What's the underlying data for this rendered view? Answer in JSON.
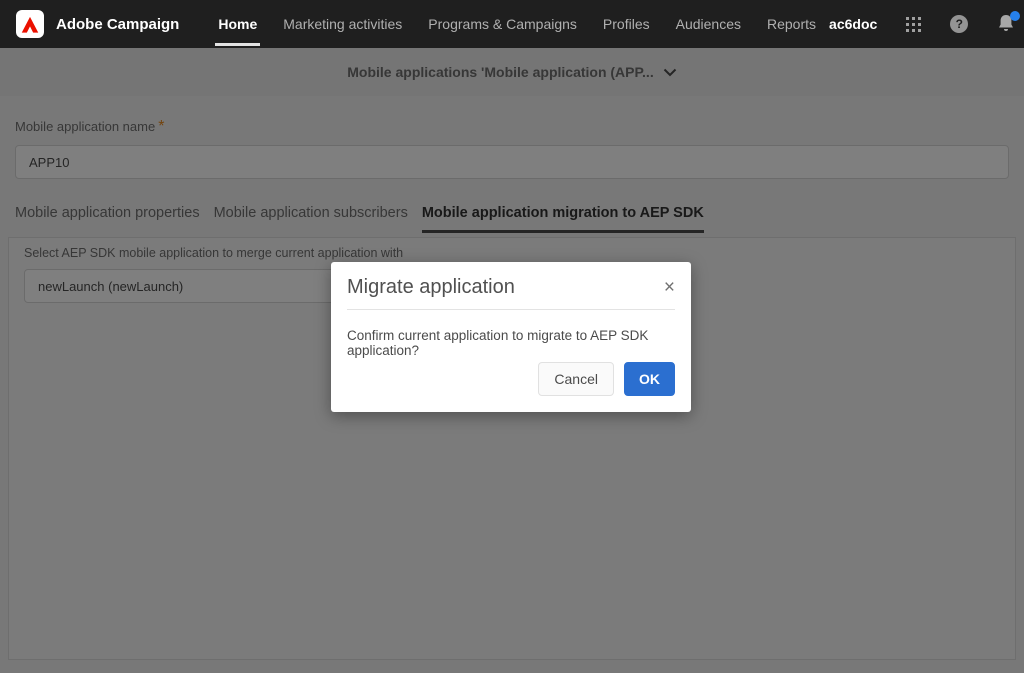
{
  "nav": {
    "brand": "Adobe Campaign",
    "items": [
      "Home",
      "Marketing activities",
      "Programs & Campaigns",
      "Profiles",
      "Audiences",
      "Reports"
    ],
    "active_item": "Home",
    "account": "ac6doc",
    "icons": [
      "adobe-logo",
      "app-grid-icon",
      "help-icon",
      "bell-icon",
      "avatar"
    ],
    "badge_color": "#2680eb"
  },
  "header": {
    "title": "Mobile applications 'Mobile application (APP..."
  },
  "form": {
    "name_label": "Mobile application name",
    "required_mark": "*",
    "required_color": "#e68619",
    "name_value": "APP10"
  },
  "tabs": [
    {
      "label": "Mobile application properties",
      "active": false
    },
    {
      "label": "Mobile application subscribers",
      "active": false
    },
    {
      "label": "Mobile application migration to AEP SDK",
      "active": true
    }
  ],
  "panel": {
    "select_label": "Select AEP SDK mobile application to merge current application with",
    "select_value": "newLaunch (newLaunch)"
  },
  "modal": {
    "title": "Migrate application",
    "close_label": "×",
    "message": "Confirm current application to migrate to AEP SDK application?",
    "cancel_label": "Cancel",
    "ok_label": "OK",
    "ok_color": "#2b6fd0"
  }
}
